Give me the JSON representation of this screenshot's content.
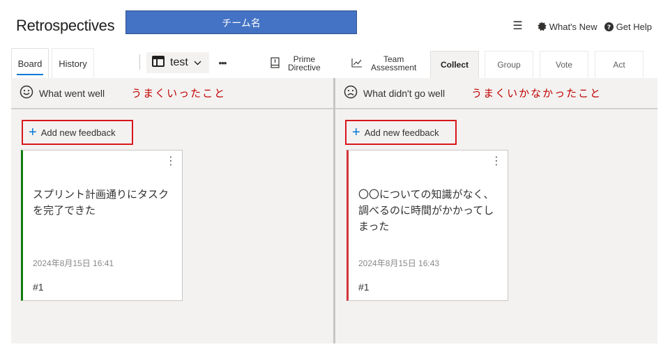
{
  "app": {
    "title": "Retrospectives",
    "team_annotation": "チーム名"
  },
  "header": {
    "whats_new": "What's New",
    "get_help": "Get Help"
  },
  "tabs": {
    "board": "Board",
    "history": "History"
  },
  "board_selector": {
    "value": "test"
  },
  "toolbar": {
    "prime_line1": "Prime",
    "prime_line2": "Directive",
    "team_line1": "Team",
    "team_line2": "Assessment"
  },
  "phases": {
    "collect": "Collect",
    "group": "Group",
    "vote": "Vote",
    "act": "Act"
  },
  "columns": [
    {
      "title": "What went well",
      "annotation": "うまくいったこと",
      "add_label": "Add new feedback",
      "card": {
        "text": "スプリント計画通りにタスクを完了できた",
        "date": "2024年8月15日 16:41",
        "id": "#1"
      },
      "accent": "#107c10"
    },
    {
      "title": "What didn't go well",
      "annotation": "うまくいかなかったこと",
      "add_label": "Add new feedback",
      "card": {
        "text": "〇〇についての知識がなく、調べるのに時間がかかってしまった",
        "date": "2024年8月15日 16:43",
        "id": "#1"
      },
      "accent": "#d13438"
    }
  ],
  "colors": {
    "accent": "#0078d4",
    "annotation": "#c00000",
    "highlight_box": "#d9151b",
    "banner": "#4472c4"
  }
}
